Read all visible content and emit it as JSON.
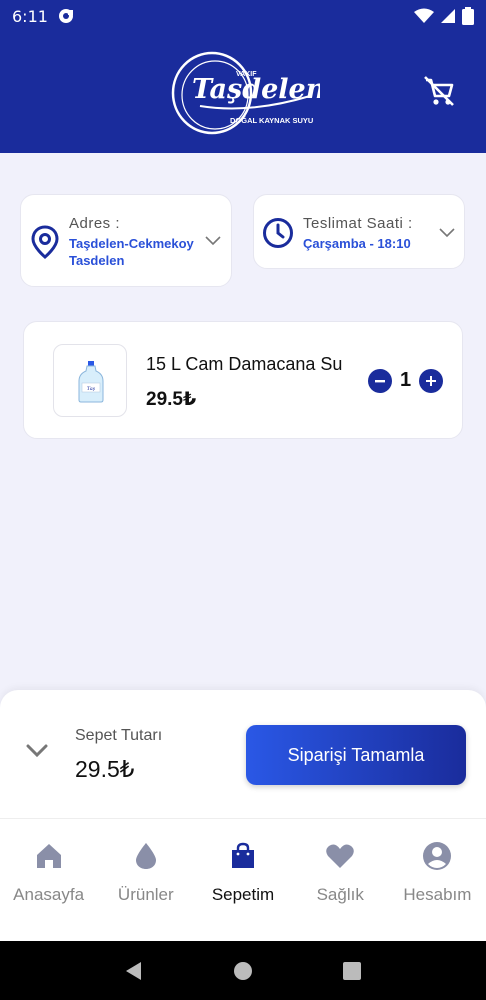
{
  "status_bar": {
    "time": "6:11"
  },
  "header": {
    "logo_text": "Taşdelen",
    "logo_small": "VAKIF",
    "logo_tagline": "DOĞAL KAYNAK SUYU"
  },
  "address": {
    "label": "Adres :",
    "value_line1": "Taşdelen-Cekmekoy",
    "value_line2": "Tasdelen"
  },
  "delivery": {
    "label": "Teslimat Saati :",
    "value": "Çarşamba - 18:10"
  },
  "cart_items": [
    {
      "name": "15 L Cam Damacana Su",
      "price": "29.5₺",
      "quantity": "1"
    }
  ],
  "summary": {
    "label": "Sepet Tutarı",
    "total": "29.5₺",
    "checkout_label": "Siparişi Tamamla"
  },
  "tabs": [
    {
      "label": "Anasayfa",
      "icon": "home-icon",
      "active": false
    },
    {
      "label": "Ürünler",
      "icon": "drop-icon",
      "active": false
    },
    {
      "label": "Sepetim",
      "icon": "bag-icon",
      "active": true
    },
    {
      "label": "Sağlık",
      "icon": "heart-icon",
      "active": false
    },
    {
      "label": "Hesabım",
      "icon": "user-icon",
      "active": false
    }
  ],
  "colors": {
    "brand": "#1a2c9c",
    "accent": "#2a50d8",
    "background": "#f1f1fb"
  }
}
